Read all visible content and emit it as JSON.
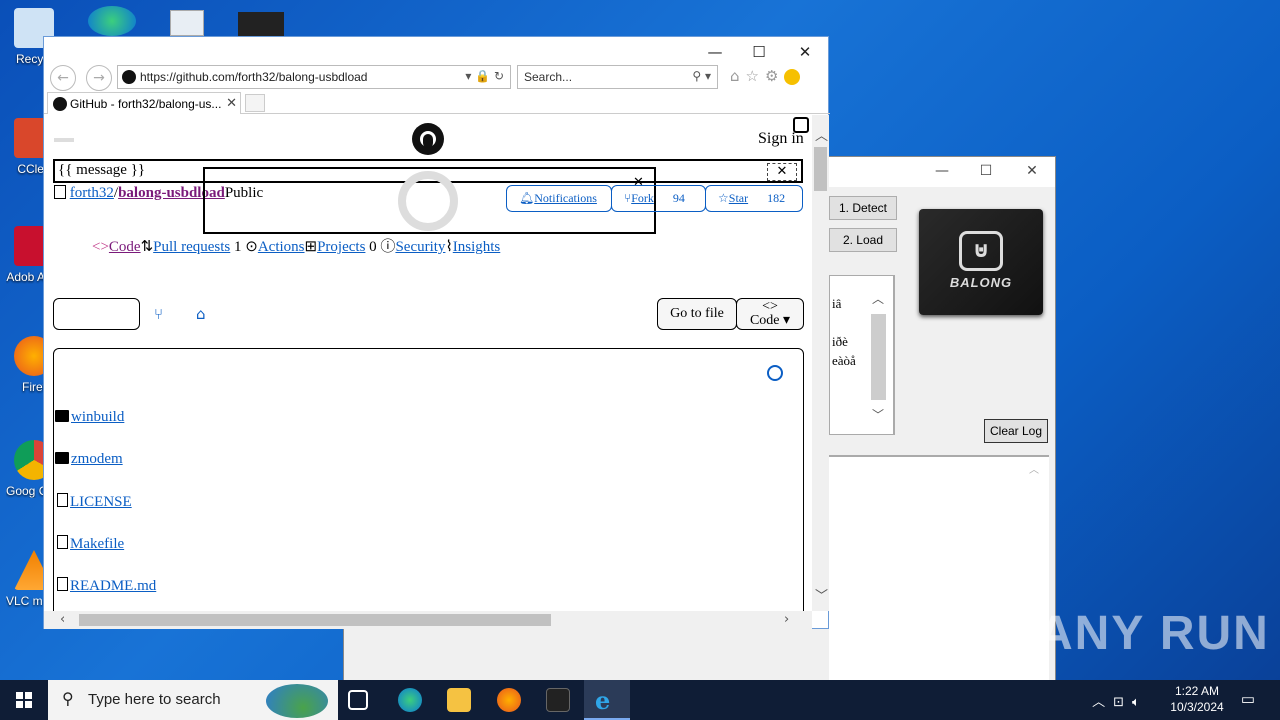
{
  "desktop": {
    "icons": [
      {
        "label": "Recycl"
      },
      {
        "label": "CClea"
      },
      {
        "label": "Adob Acro"
      },
      {
        "label": "Firef"
      },
      {
        "label": "Goog Chro"
      },
      {
        "label": "VLC m play"
      }
    ]
  },
  "app_window": {
    "detect_label": "1. Detect",
    "load_label": "2. Load",
    "clear_log_label": "Clear Log",
    "log_line1": "iâ",
    "log_line2": "iðè",
    "log_line3": "eàòå",
    "chip_brand": "BALONG"
  },
  "browser": {
    "url": "https://github.com/forth32/balong-usbdload",
    "search_placeholder": "Search...",
    "tab_title": "GitHub - forth32/balong-us...",
    "tab_close": "✕"
  },
  "page": {
    "sign_in": "Sign in",
    "flash_message": "{{ message }}",
    "owner": "forth32",
    "separator": "/",
    "repo": "balong-usbdload",
    "visibility": "Public",
    "notifications_label": "Notifications",
    "fork_label": "Fork",
    "fork_count": "94",
    "star_label": "Star",
    "star_count": "182",
    "nav": {
      "code": "Code",
      "pulls": "Pull requests",
      "pulls_count": "1",
      "actions": "Actions",
      "projects": "Projects",
      "projects_count": "0",
      "security": "Security",
      "insights": "Insights"
    },
    "go_to_file": "Go to file",
    "code_button": "Code",
    "code_glyph": "<>",
    "files": [
      "winbuild",
      "zmodem",
      "LICENSE",
      "Makefile",
      "README.md"
    ]
  },
  "taskbar": {
    "search_placeholder": "Type here to search",
    "time": "1:22 AM",
    "date": "10/3/2024"
  },
  "watermark": "ANY RUN"
}
